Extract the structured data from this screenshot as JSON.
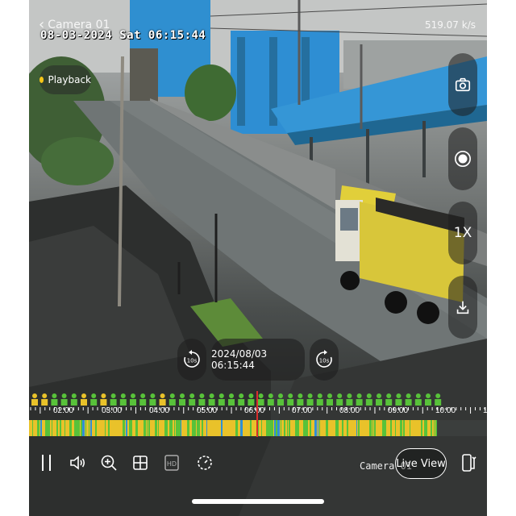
{
  "header": {
    "back_label": "Camera 01",
    "timestamp_overlay": "08-03-2024 Sat 06:15:44",
    "bitrate": "519.07 k/s"
  },
  "playback_badge": {
    "label": "Playback",
    "dot_color": "#f5c518"
  },
  "side_controls": {
    "snapshot_icon": "camera-icon",
    "record_icon": "record-icon",
    "zoom_label": "1X",
    "download_icon": "download-icon"
  },
  "seek": {
    "rewind_label": "10s",
    "forward_label": "10s",
    "current_time": "2024/08/03 06:15:44"
  },
  "timeline": {
    "tick_labels": [
      "02:00",
      "03:00",
      "04:00",
      "05:00",
      "06:00",
      "07:00",
      "08:00",
      "09:00",
      "10:00",
      "1"
    ],
    "recording_colors": {
      "continuous": "#e9c22a",
      "motion": "#58c23a",
      "event": "#2f8fd6"
    },
    "cursor_color": "#d92d2d"
  },
  "bottom_bar": {
    "pause_icon": "pause-icon",
    "volume_icon": "speaker-icon",
    "zoom_icon": "zoom-in-icon",
    "grid_icon": "grid-icon",
    "hd_label": "HD",
    "speed_icon": "speed-icon",
    "camera_label": "Camera 01",
    "live_view_label": "Live View",
    "rotate_icon": "rotate-screen-icon"
  }
}
